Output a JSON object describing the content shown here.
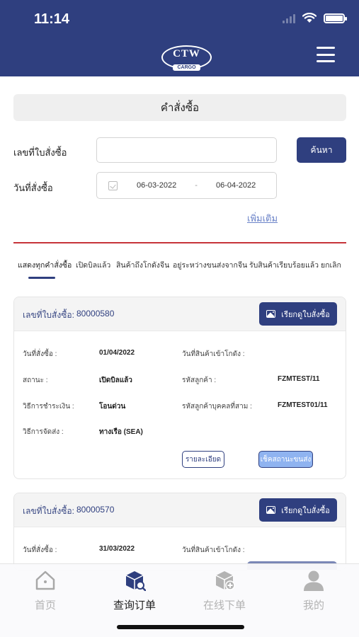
{
  "status_bar": {
    "time": "11:14"
  },
  "header": {
    "logo_text": "CTW",
    "logo_sub": "CARGO",
    "menu_icon": "hamburger-menu-icon"
  },
  "page": {
    "title": "คำสั่งซื้อ"
  },
  "form": {
    "order_no_label": "เลขที่ใบสั่งซื้อ",
    "order_no_value": "",
    "search_label": "ค้นหา",
    "date_label": "วันที่สั่งซื้อ",
    "date_from": "06-03-2022",
    "date_sep": "-",
    "date_to": "06-04-2022",
    "more_link": "เพิ่มเติม"
  },
  "tabs": [
    {
      "label": "แสดงทุกคำสั่งซื้อ",
      "active": true
    },
    {
      "label": "เปิดบิลแล้ว",
      "active": false
    },
    {
      "label": "สินค้าถึงโกดังจีน",
      "active": false
    },
    {
      "label": "อยู่ระหว่างขนส่งจากจีน",
      "active": false
    },
    {
      "label": "รับสินค้าเรียบร้อยแล้ว",
      "active": false
    },
    {
      "label": "ยกเลิก",
      "active": false
    }
  ],
  "orders": [
    {
      "order_label": "เลขที่ใบสั่งซื้อ:",
      "order_no": "80000580",
      "view_btn": "เรียกดูใบสั่งซื้อ",
      "fields": {
        "order_date_label": "วันที่สั่งซื้อ :",
        "order_date": "01/04/2022",
        "arrive_label": "วันที่สินค้าเข้าโกดัง :",
        "arrive": "",
        "status_label": "สถานะ :",
        "status": "เปิดบิลแล้ว",
        "customer_code_label": "รหัสลูกค้า :",
        "customer_code": "FZMTEST/11",
        "payment_label": "วิธีการชำระเงิน :",
        "payment": "โอนด่วน",
        "third_party_label": "รหัสลูกค้าบุคคลที่สาม :",
        "third_party": "FZMTEST01/11",
        "shipping_label": "วิธีการจัดส่ง :",
        "shipping": "ทางเรือ (SEA)"
      },
      "detail_btn": "รายละเอียด",
      "track_btn": "เช็คสถานะขนส่ง"
    },
    {
      "order_label": "เลขที่ใบสั่งซื้อ:",
      "order_no": "80000570",
      "view_btn": "เรียกดูใบสั่งซื้อ",
      "fields": {
        "order_date_label": "วันที่สั่งซื้อ :",
        "order_date": "31/03/2022",
        "arrive_label": "วันที่สินค้าเข้าโกดัง :",
        "arrive": ""
      }
    }
  ],
  "bottom_nav": [
    {
      "label": "首页",
      "icon": "home-icon",
      "active": false
    },
    {
      "label": "查询订单",
      "icon": "order-search-icon",
      "active": true
    },
    {
      "label": "在线下单",
      "icon": "order-add-icon",
      "active": false
    },
    {
      "label": "我的",
      "icon": "user-icon",
      "active": false
    }
  ],
  "colors": {
    "primary": "#2f3f7f",
    "accent_red": "#c6333a",
    "link": "#6a82c8",
    "track_btn": "#8fb3f0"
  }
}
